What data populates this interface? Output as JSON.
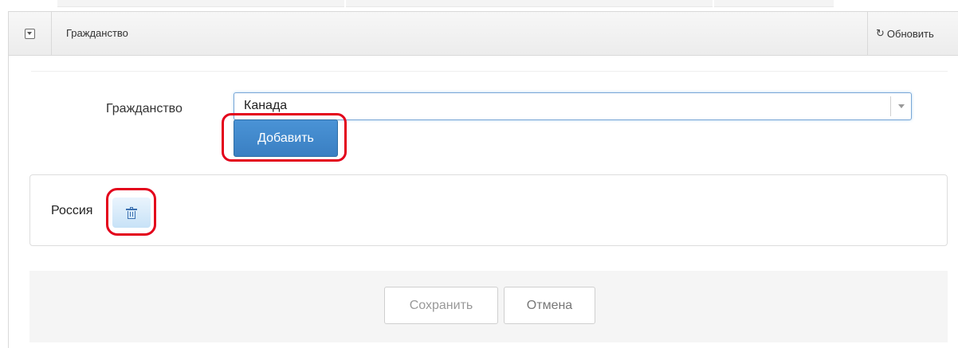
{
  "panel": {
    "title": "Гражданство",
    "refresh_label": "Обновить",
    "refresh_icon": "↻"
  },
  "form": {
    "label": "Гражданство",
    "select_value": "Канада",
    "add_label": "Добавить"
  },
  "list": {
    "items": [
      {
        "label": "Россия"
      }
    ]
  },
  "footer": {
    "save_label": "Сохранить",
    "cancel_label": "Отмена"
  },
  "colors": {
    "primary": "#3f88cb",
    "highlight": "#e3001b",
    "header_bg": "#f0f0f0"
  }
}
